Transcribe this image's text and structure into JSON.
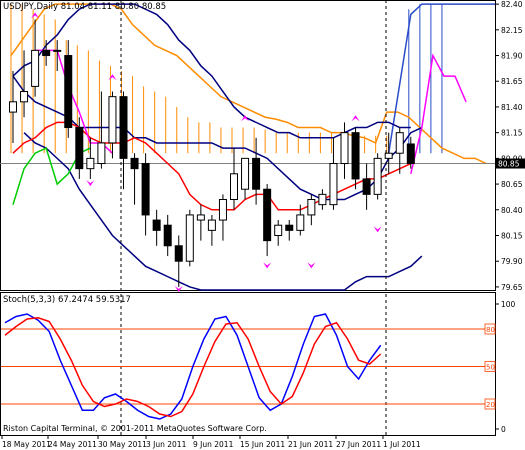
{
  "main_panel": {
    "header": "USDJPY,Daily  81.04 81.11 80.80 80.85",
    "current_price_label": "80.85",
    "ylim": [
      79.62,
      82.44
    ],
    "y_ticks": [
      "82.40",
      "82.15",
      "81.90",
      "81.65",
      "81.40",
      "81.15",
      "80.90",
      "80.65",
      "80.40",
      "80.15",
      "79.90",
      "79.65"
    ]
  },
  "stoch_panel": {
    "header": "Stoch(5,3,3) 67.2474 59.5317",
    "level_labels": [
      "80",
      "50",
      "20"
    ],
    "y_ticks": [
      "100",
      "0"
    ],
    "copyright": "Riston Capital Terminal, © 2001-2011 MetaQuotes Software Corp."
  },
  "x_axis": {
    "labels": [
      "18 May 2011",
      "24 May 2011",
      "30 May 2011",
      "3 Jun 2011",
      "9 Jun 2011",
      "15 Jun 2011",
      "21 Jun 2011",
      "27 Jun 2011",
      "1 Jul 2011"
    ]
  },
  "colors": {
    "bull_candle": "#ffffff",
    "bear_candle": "#000000",
    "cloud_orange": "#ff8c00",
    "cloud_blue": "#2a4cc8",
    "tenkan": "#ff0000",
    "kijun": "#000080",
    "chikou": "#00cc00",
    "fractal_magenta": "#ff00ff",
    "stoch_main": "#0000ff",
    "stoch_signal": "#ff0000",
    "level_line": "#ff4500",
    "price_line": "#808080"
  },
  "chart_data": [
    {
      "type": "candlestick",
      "title": "USDJPY,Daily",
      "ylim": [
        79.62,
        82.44
      ],
      "series": [
        {
          "name": "candles",
          "values": [
            {
              "x": 0,
              "o": 81.35,
              "h": 81.75,
              "l": 81.05,
              "c": 81.45
            },
            {
              "x": 1,
              "o": 81.45,
              "h": 81.95,
              "l": 81.3,
              "c": 81.55
            },
            {
              "x": 2,
              "o": 81.6,
              "h": 82.25,
              "l": 81.5,
              "c": 81.95
            },
            {
              "x": 3,
              "o": 81.95,
              "h": 82.05,
              "l": 81.8,
              "c": 81.9
            },
            {
              "x": 4,
              "o": 81.95,
              "h": 82.05,
              "l": 81.75,
              "c": 81.95
            },
            {
              "x": 5,
              "o": 81.9,
              "h": 82.05,
              "l": 81.1,
              "c": 81.2
            },
            {
              "x": 6,
              "o": 81.2,
              "h": 81.3,
              "l": 80.7,
              "c": 80.8
            },
            {
              "x": 7,
              "o": 80.8,
              "h": 81.1,
              "l": 80.7,
              "c": 80.9
            },
            {
              "x": 8,
              "o": 80.85,
              "h": 81.55,
              "l": 80.8,
              "c": 81.05
            },
            {
              "x": 9,
              "o": 81.05,
              "h": 81.55,
              "l": 80.9,
              "c": 81.5
            },
            {
              "x": 10,
              "o": 81.5,
              "h": 81.55,
              "l": 80.6,
              "c": 80.9
            },
            {
              "x": 11,
              "o": 80.9,
              "h": 80.95,
              "l": 80.45,
              "c": 80.8
            },
            {
              "x": 12,
              "o": 80.85,
              "h": 80.95,
              "l": 80.15,
              "c": 80.35
            },
            {
              "x": 13,
              "o": 80.3,
              "h": 80.4,
              "l": 80.05,
              "c": 80.2
            },
            {
              "x": 14,
              "o": 80.25,
              "h": 80.35,
              "l": 79.95,
              "c": 80.05
            },
            {
              "x": 15,
              "o": 80.05,
              "h": 80.15,
              "l": 79.65,
              "c": 79.9
            },
            {
              "x": 16,
              "o": 79.9,
              "h": 80.4,
              "l": 79.85,
              "c": 80.35
            },
            {
              "x": 17,
              "o": 80.3,
              "h": 80.45,
              "l": 80.1,
              "c": 80.35
            },
            {
              "x": 18,
              "o": 80.2,
              "h": 80.35,
              "l": 80.05,
              "c": 80.3
            },
            {
              "x": 19,
              "o": 80.3,
              "h": 80.55,
              "l": 80.1,
              "c": 80.5
            },
            {
              "x": 20,
              "o": 80.5,
              "h": 81.0,
              "l": 80.4,
              "c": 80.75
            },
            {
              "x": 21,
              "o": 80.6,
              "h": 80.9,
              "l": 80.5,
              "c": 80.9
            },
            {
              "x": 22,
              "o": 80.9,
              "h": 81.1,
              "l": 80.45,
              "c": 80.6
            },
            {
              "x": 23,
              "o": 80.6,
              "h": 80.65,
              "l": 79.95,
              "c": 80.1
            },
            {
              "x": 24,
              "o": 80.15,
              "h": 80.3,
              "l": 80.05,
              "c": 80.25
            },
            {
              "x": 25,
              "o": 80.25,
              "h": 80.3,
              "l": 80.1,
              "c": 80.2
            },
            {
              "x": 26,
              "o": 80.2,
              "h": 80.45,
              "l": 80.15,
              "c": 80.35
            },
            {
              "x": 27,
              "o": 80.35,
              "h": 80.55,
              "l": 80.25,
              "c": 80.5
            },
            {
              "x": 28,
              "o": 80.45,
              "h": 80.6,
              "l": 80.4,
              "c": 80.55
            },
            {
              "x": 29,
              "o": 80.45,
              "h": 81.1,
              "l": 80.4,
              "c": 80.85
            },
            {
              "x": 30,
              "o": 80.85,
              "h": 81.25,
              "l": 80.7,
              "c": 81.15
            },
            {
              "x": 31,
              "o": 81.15,
              "h": 81.2,
              "l": 80.6,
              "c": 80.7
            },
            {
              "x": 32,
              "o": 80.7,
              "h": 80.85,
              "l": 80.4,
              "c": 80.55
            },
            {
              "x": 33,
              "o": 80.55,
              "h": 80.95,
              "l": 80.5,
              "c": 80.9
            },
            {
              "x": 34,
              "o": 80.9,
              "h": 81.15,
              "l": 80.75,
              "c": 80.95
            },
            {
              "x": 35,
              "o": 80.95,
              "h": 81.2,
              "l": 80.75,
              "c": 81.15
            },
            {
              "x": 36,
              "o": 81.04,
              "h": 81.11,
              "l": 80.8,
              "c": 80.85
            }
          ]
        }
      ]
    },
    {
      "type": "line",
      "title": "Stoch(5,3,3)",
      "ylim": [
        0,
        100
      ],
      "series": [
        {
          "name": "Main",
          "values": [
            85,
            90,
            92,
            87,
            78,
            55,
            35,
            15,
            15,
            25,
            28,
            22,
            15,
            10,
            8,
            12,
            24,
            50,
            72,
            88,
            90,
            75,
            50,
            25,
            15,
            20,
            42,
            68,
            90,
            92,
            75,
            50,
            40,
            55,
            67
          ]
        },
        {
          "name": "Signal",
          "values": [
            75,
            82,
            88,
            89,
            86,
            72,
            55,
            35,
            22,
            18,
            20,
            24,
            22,
            18,
            12,
            10,
            14,
            28,
            50,
            70,
            84,
            85,
            72,
            50,
            30,
            20,
            26,
            45,
            68,
            82,
            85,
            72,
            55,
            52,
            60
          ]
        }
      ]
    }
  ]
}
